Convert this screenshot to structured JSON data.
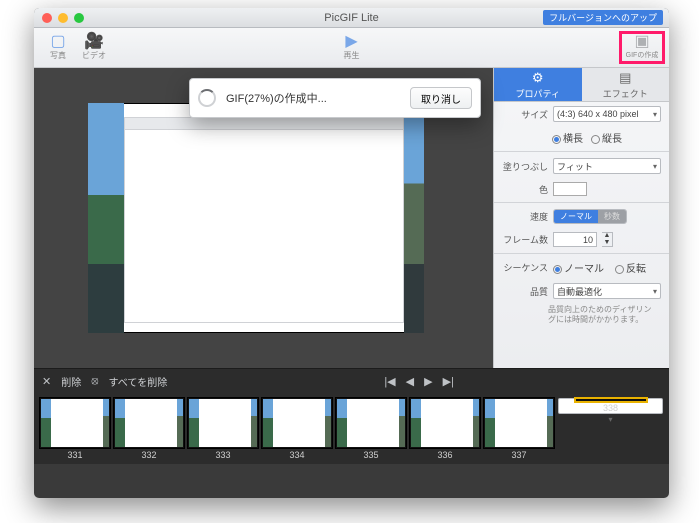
{
  "window": {
    "title": "PicGIF Lite",
    "upgrade": "フルバージョンへのアップ"
  },
  "toolbar": {
    "photo": "写真",
    "video": "ビデオ",
    "play": "再生",
    "make": "GIFの作成"
  },
  "tabs": {
    "property": "プロパティ",
    "effect": "エフェクト"
  },
  "panel": {
    "size_label": "サイズ",
    "size_value": "(4:3) 640 x 480 pixel",
    "orient_h": "横長",
    "orient_v": "縦長",
    "fill_label": "塗りつぶし",
    "fill_value": "フィット",
    "color_label": "色",
    "speed_label": "速度",
    "speed_normal": "ノーマル",
    "speed_other": "秒数",
    "frames_label": "フレーム数",
    "frames_value": "10",
    "sequence_label": "シーケンス",
    "seq_normal": "ノーマル",
    "seq_reverse": "反転",
    "quality_label": "品質",
    "quality_value": "自動最適化",
    "quality_note": "品質向上のためのディザリングには時間がかかります。"
  },
  "controls": {
    "delete": "削除",
    "delete_all": "すべてを削除"
  },
  "frames": [
    {
      "n": "331"
    },
    {
      "n": "332"
    },
    {
      "n": "333"
    },
    {
      "n": "334"
    },
    {
      "n": "335"
    },
    {
      "n": "336"
    },
    {
      "n": "337"
    },
    {
      "n": "338"
    }
  ],
  "dialog": {
    "message": "GIF(27%)の作成中...",
    "cancel": "取り消し"
  }
}
